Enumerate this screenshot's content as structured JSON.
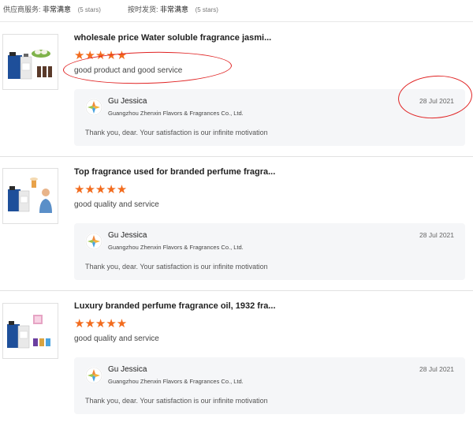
{
  "summary": {
    "supplier_service": {
      "label": "供应商服务:",
      "value": "非常满意",
      "stars": "(5 stars)"
    },
    "on_time_shipping": {
      "label": "按时发货:",
      "value": "非常满意",
      "stars": "(5 stars)"
    }
  },
  "reviews": [
    {
      "title": "wholesale price Water soluble fragrance jasmi...",
      "rating": 5,
      "stars": "★★★★★",
      "comment": "good product and good service",
      "reply": {
        "name": "Gu Jessica",
        "company": "Guangzhou Zhenxin Flavors & Fragrances Co., Ltd.",
        "date": "28 Jul 2021",
        "message": "Thank you, dear. Your satisfaction is our infinite motivation"
      }
    },
    {
      "title": "Top fragrance used for branded perfume fragra...",
      "rating": 5,
      "stars": "★★★★★",
      "comment": "good quality and service",
      "reply": {
        "name": "Gu Jessica",
        "company": "Guangzhou Zhenxin Flavors & Fragrances Co., Ltd.",
        "date": "28 Jul 2021",
        "message": "Thank you, dear. Your satisfaction is our infinite motivation"
      }
    },
    {
      "title": "Luxury branded perfume fragrance oil, 1932 fra...",
      "rating": 5,
      "stars": "★★★★★",
      "comment": "good quality and service",
      "reply": {
        "name": "Gu Jessica",
        "company": "Guangzhou Zhenxin Flavors & Fragrances Co., Ltd.",
        "date": "28 Jul 2021",
        "message": "Thank you, dear. Your satisfaction is our infinite motivation"
      }
    }
  ],
  "colors": {
    "star": "#f26b1d",
    "annotation": "#e02222",
    "reply_bg": "#f5f6f8"
  },
  "icons": {
    "avatar": "supplier-logo-icon"
  }
}
